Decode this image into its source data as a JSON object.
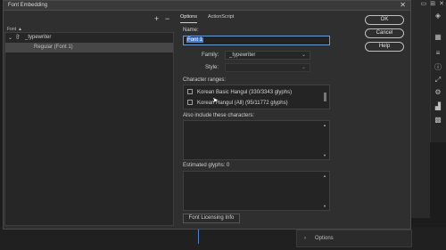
{
  "dialog": {
    "title": "Font Embedding"
  },
  "left": {
    "font_label": "Font",
    "sort_icon": "▲",
    "tree": {
      "parent": "_typewriter",
      "child": "Regular (Font 1)"
    }
  },
  "tabs": [
    {
      "label": "Options"
    },
    {
      "label": "ActionScript"
    }
  ],
  "fields": {
    "name_label": "Name:",
    "name_value": "Font 1",
    "family_label": "Family:",
    "family_value": "_typewriter",
    "style_label": "Style:",
    "style_value": "",
    "ranges_label": "Character ranges:",
    "ranges": [
      "Korean Basic Hangul (330/3343 glyphs)",
      "Korean Hangul (All) (95/11772 glyphs)"
    ],
    "include_label": "Also include these characters:",
    "estimated_label": "Estimated glyphs: 0",
    "licensing_button": "Font Licensing Info"
  },
  "buttons": {
    "ok": "OK",
    "cancel": "Cancel",
    "help": "Help"
  },
  "background": {
    "options_panel": "Options"
  }
}
